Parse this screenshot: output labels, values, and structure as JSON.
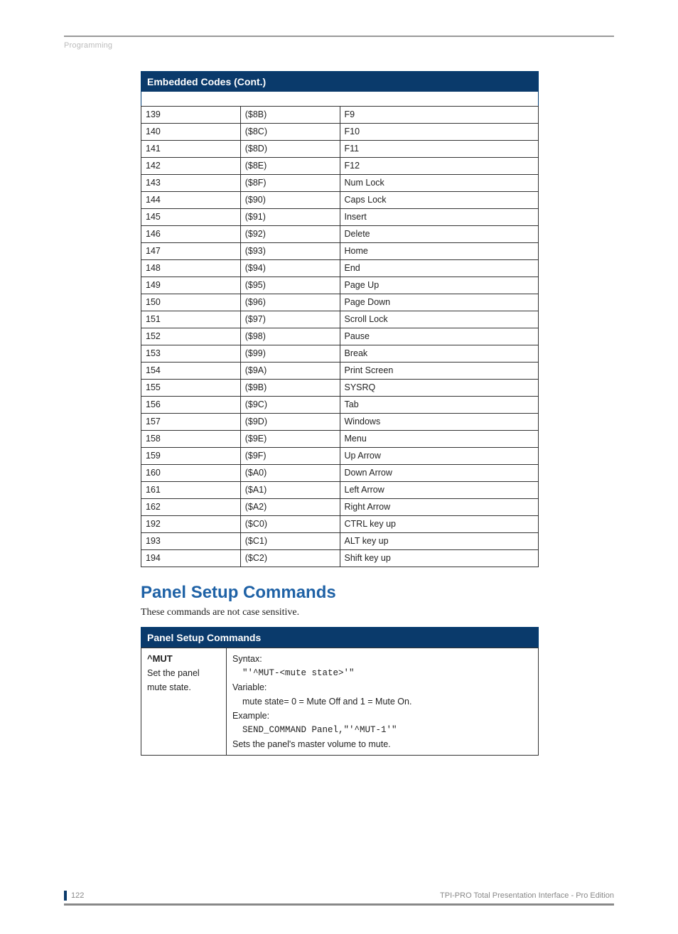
{
  "header": {
    "section_label": "Programming"
  },
  "table1": {
    "title": "Embedded Codes (Cont.)",
    "rows": [
      {
        "dec": "139",
        "hex": "($8B)",
        "name": "F9"
      },
      {
        "dec": "140",
        "hex": "($8C)",
        "name": "F10"
      },
      {
        "dec": "141",
        "hex": "($8D)",
        "name": "F11"
      },
      {
        "dec": "142",
        "hex": "($8E)",
        "name": "F12"
      },
      {
        "dec": "143",
        "hex": "($8F)",
        "name": "Num Lock"
      },
      {
        "dec": "144",
        "hex": "($90)",
        "name": "Caps Lock"
      },
      {
        "dec": "145",
        "hex": "($91)",
        "name": "Insert"
      },
      {
        "dec": "146",
        "hex": "($92)",
        "name": "Delete"
      },
      {
        "dec": "147",
        "hex": "($93)",
        "name": "Home"
      },
      {
        "dec": "148",
        "hex": "($94)",
        "name": "End"
      },
      {
        "dec": "149",
        "hex": "($95)",
        "name": "Page Up"
      },
      {
        "dec": "150",
        "hex": "($96)",
        "name": "Page Down"
      },
      {
        "dec": "151",
        "hex": "($97)",
        "name": "Scroll Lock"
      },
      {
        "dec": "152",
        "hex": "($98)",
        "name": "Pause"
      },
      {
        "dec": "153",
        "hex": "($99)",
        "name": "Break"
      },
      {
        "dec": "154",
        "hex": "($9A)",
        "name": "Print Screen"
      },
      {
        "dec": "155",
        "hex": "($9B)",
        "name": "SYSRQ"
      },
      {
        "dec": "156",
        "hex": "($9C)",
        "name": "Tab"
      },
      {
        "dec": "157",
        "hex": "($9D)",
        "name": "Windows"
      },
      {
        "dec": "158",
        "hex": "($9E)",
        "name": "Menu"
      },
      {
        "dec": "159",
        "hex": "($9F)",
        "name": "Up Arrow"
      },
      {
        "dec": "160",
        "hex": "($A0)",
        "name": "Down Arrow"
      },
      {
        "dec": "161",
        "hex": "($A1)",
        "name": "Left Arrow"
      },
      {
        "dec": "162",
        "hex": "($A2)",
        "name": "Right Arrow"
      },
      {
        "dec": "192",
        "hex": "($C0)",
        "name": "CTRL key up"
      },
      {
        "dec": "193",
        "hex": "($C1)",
        "name": "ALT key up"
      },
      {
        "dec": "194",
        "hex": "($C2)",
        "name": "Shift key up"
      }
    ]
  },
  "section2": {
    "heading": "Panel Setup Commands",
    "intro": "These commands are not case sensitive."
  },
  "table2": {
    "title": "Panel Setup Commands",
    "cmd_name": "^MUT",
    "cmd_desc": "Set the panel mute state.",
    "syntax_label": "Syntax:",
    "syntax_code": "\"'^MUT-<mute state>'\"",
    "variable_label": "Variable:",
    "variable_text": "mute state= 0 = Mute Off and 1 = Mute On.",
    "example_label": "Example:",
    "example_code": "SEND_COMMAND Panel,\"'^MUT-1'\"",
    "result_text": "Sets the panel's master volume to mute."
  },
  "footer": {
    "page_number": "122",
    "doc_title": "TPI-PRO Total Presentation Interface - Pro Edition"
  }
}
